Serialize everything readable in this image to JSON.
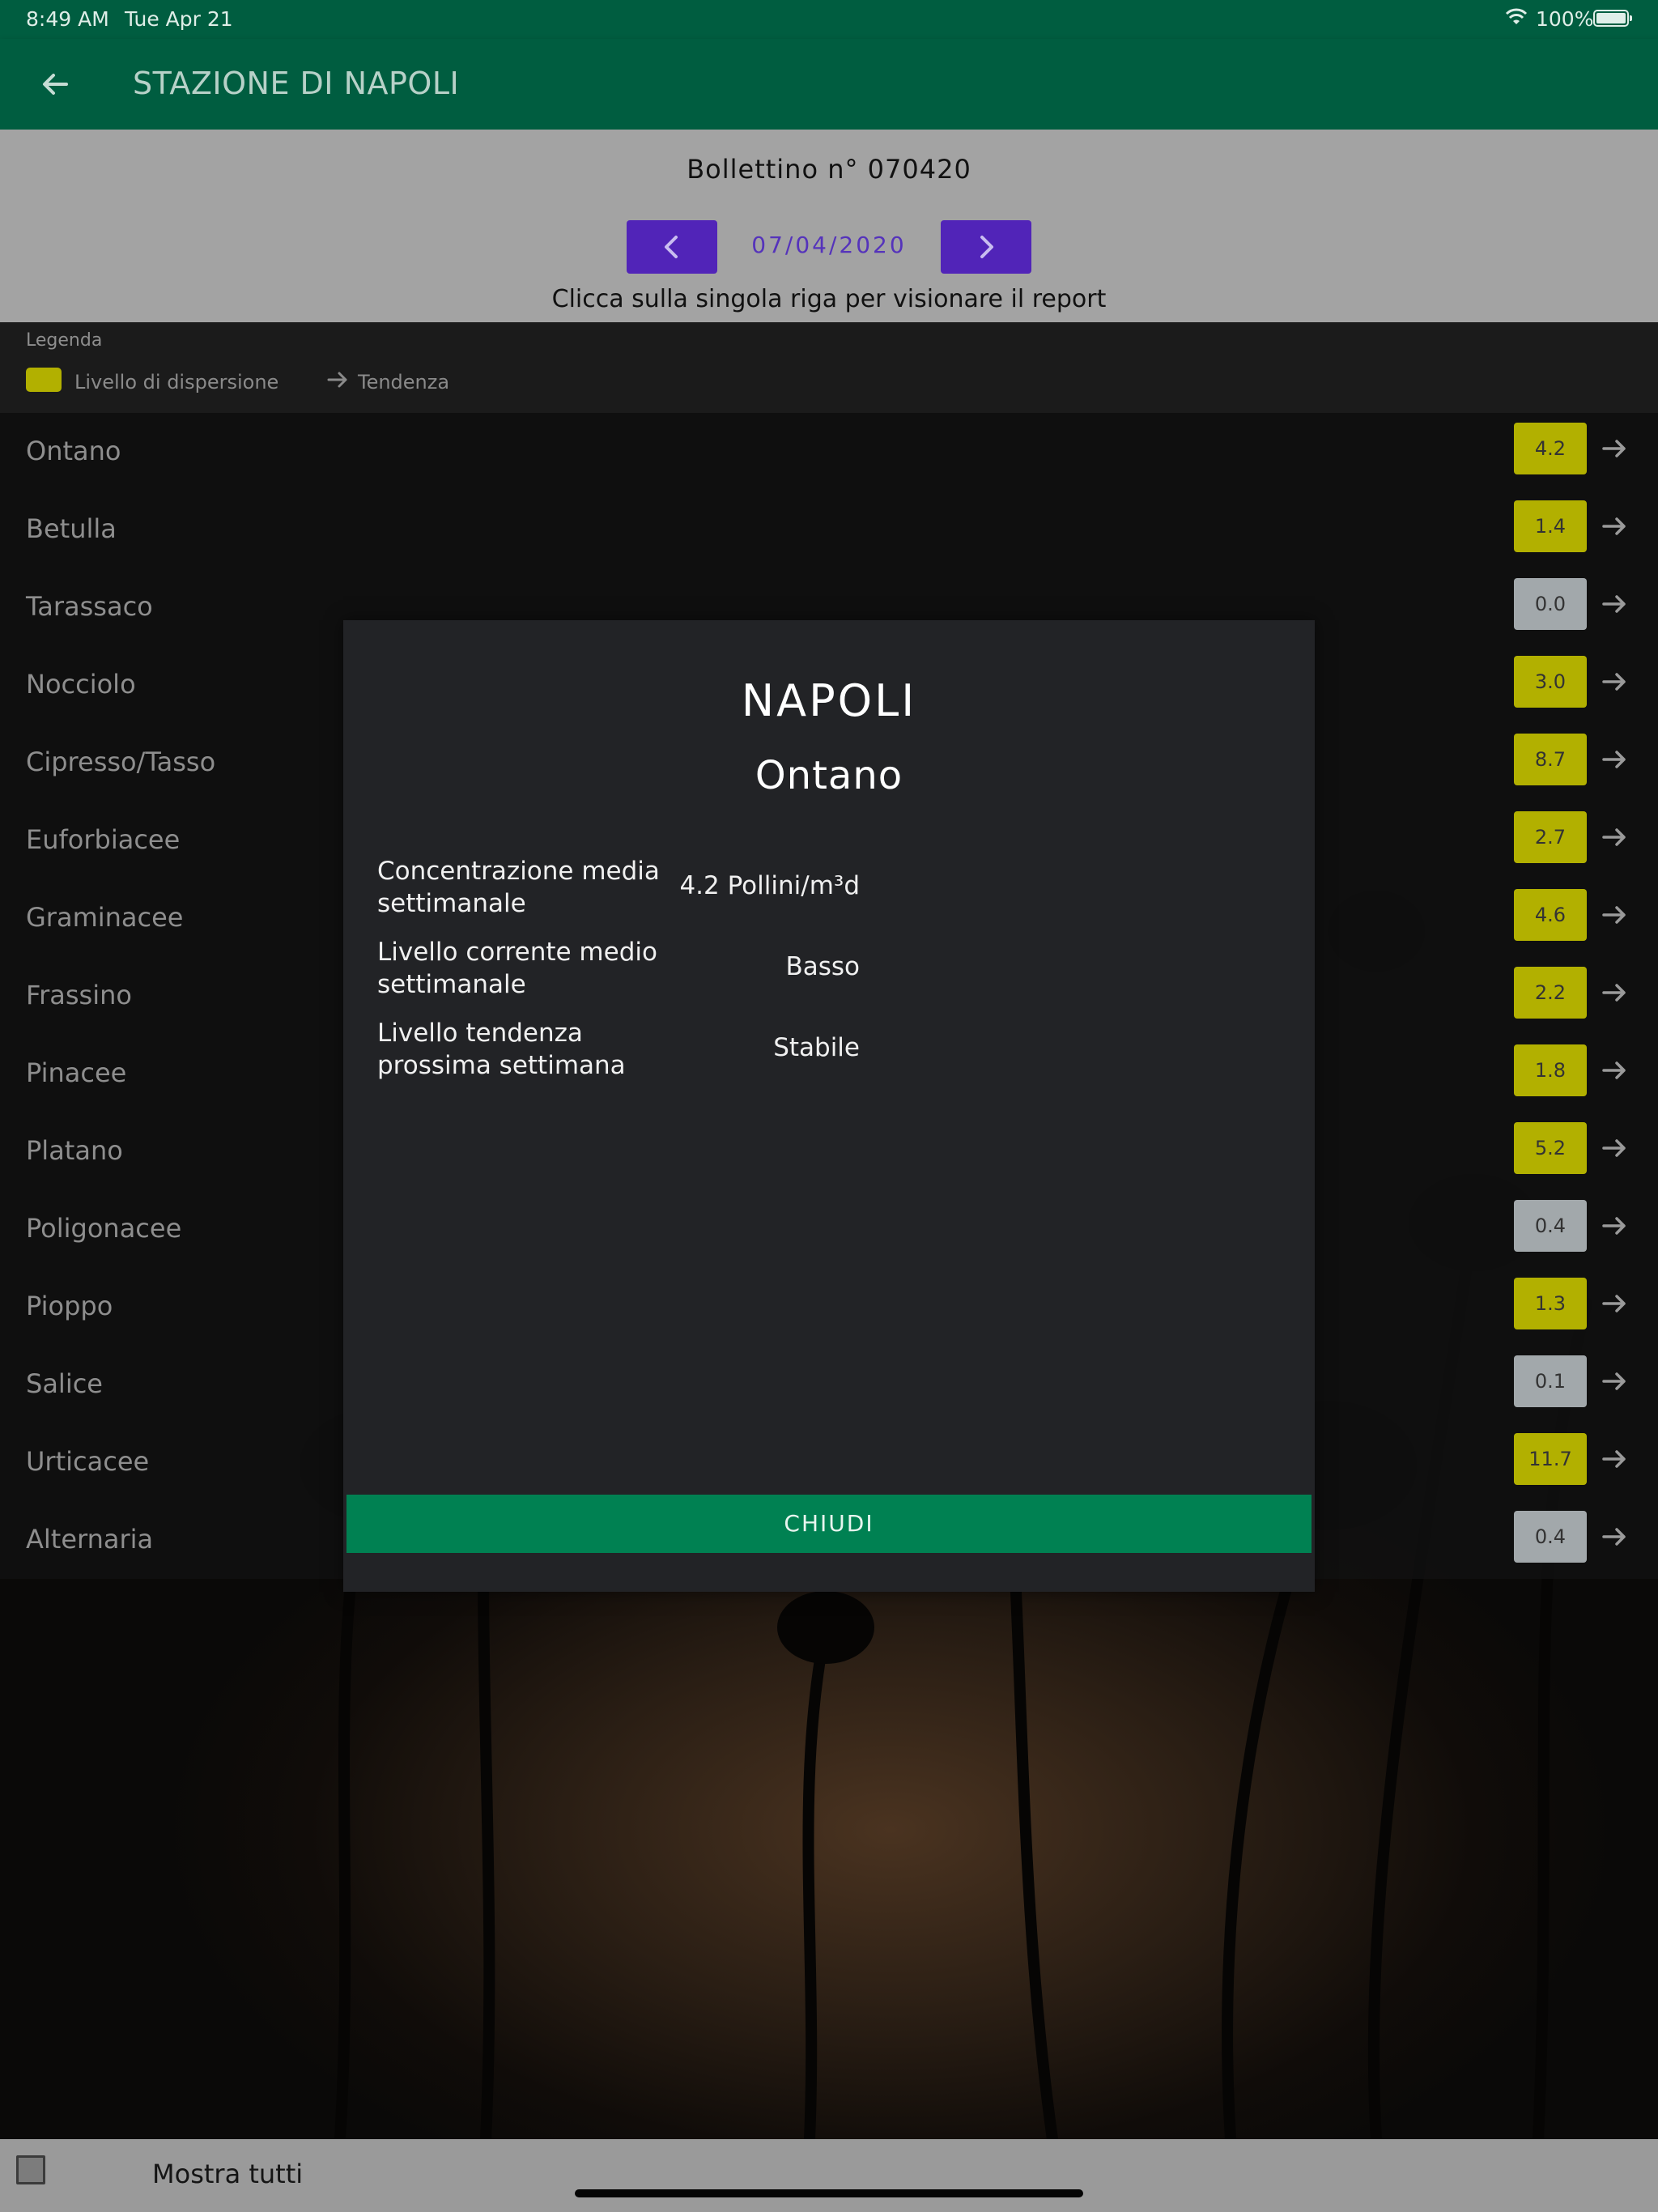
{
  "status_bar": {
    "time": "8:49 AM",
    "date": "Tue Apr 21",
    "battery": "100%"
  },
  "header": {
    "title": "STAZIONE DI NAPOLI"
  },
  "bulletin": {
    "number": "Bollettino n° 070420",
    "date": "07/04/2020",
    "hint": "Clicca sulla singola riga per visionare il report"
  },
  "legend": {
    "title": "Legenda",
    "dispersion_label": "Livello di dispersione",
    "trend_label": "Tendenza"
  },
  "colors": {
    "header": "#005d40",
    "nav_button": "#5124b8",
    "level_yellow": "#b2b000",
    "level_grey": "#a2a8ab",
    "close_button": "#008152"
  },
  "pollens": [
    {
      "name": "Ontano",
      "value": "4.2",
      "level": "yellow"
    },
    {
      "name": "Betulla",
      "value": "1.4",
      "level": "yellow"
    },
    {
      "name": "Tarassaco",
      "value": "0.0",
      "level": "grey"
    },
    {
      "name": "Nocciolo",
      "value": "3.0",
      "level": "yellow"
    },
    {
      "name": "Cipresso/Tasso",
      "value": "8.7",
      "level": "yellow"
    },
    {
      "name": "Euforbiacee",
      "value": "2.7",
      "level": "yellow"
    },
    {
      "name": "Graminacee",
      "value": "4.6",
      "level": "yellow"
    },
    {
      "name": "Frassino",
      "value": "2.2",
      "level": "yellow"
    },
    {
      "name": "Pinacee",
      "value": "1.8",
      "level": "yellow"
    },
    {
      "name": "Platano",
      "value": "5.2",
      "level": "yellow"
    },
    {
      "name": "Poligonacee",
      "value": "0.4",
      "level": "grey"
    },
    {
      "name": "Pioppo",
      "value": "1.3",
      "level": "yellow"
    },
    {
      "name": "Salice",
      "value": "0.1",
      "level": "grey"
    },
    {
      "name": "Urticacee",
      "value": "11.7",
      "level": "yellow"
    },
    {
      "name": "Alternaria",
      "value": "0.4",
      "level": "grey"
    }
  ],
  "modal": {
    "city": "NAPOLI",
    "species": "Ontano",
    "rows": [
      {
        "label": "Concentrazione media settimanale",
        "value": "4.2 Pollini/m³d"
      },
      {
        "label": "Livello corrente medio settimanale",
        "value": "Basso"
      },
      {
        "label": "Livello tendenza prossima settimana",
        "value": "Stabile"
      }
    ],
    "close_label": "CHIUDI"
  },
  "footer": {
    "show_all_label": "Mostra tutti",
    "show_all_checked": false
  }
}
